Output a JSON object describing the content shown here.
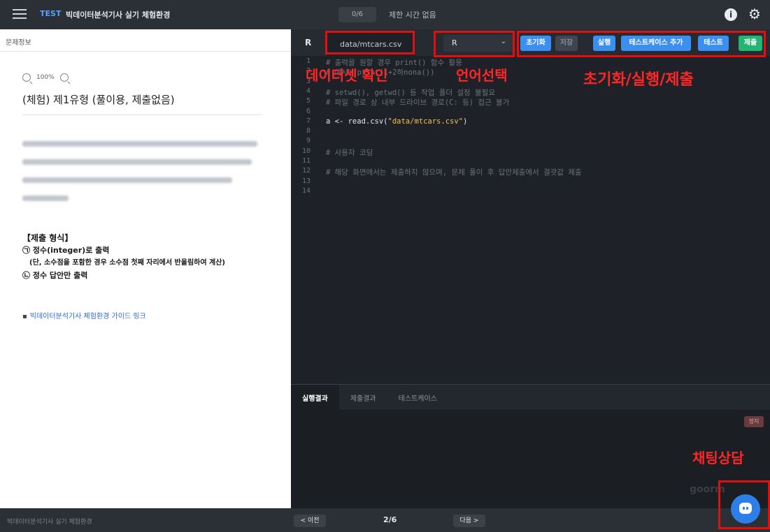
{
  "topbar": {
    "tag": "TEST",
    "title": "빅데이터분석기사 실기 체험환경",
    "progress": "0/6",
    "time_limit": "제한 시간 없음"
  },
  "left": {
    "header": "문제정보",
    "zoom": "100%",
    "question_title": "(체험) 제1유형 (풀이용, 제출없음)",
    "format_heading": "【제출 형식】",
    "format_1": "㉠ 정수(integer)로 출력",
    "format_1_note": "(단, 소수점을 포함한 경우 소수점 첫째 자리에서 반올림하여 계산)",
    "format_2": "㉡ 정수 답안만 출력",
    "guide_bullet": "▪",
    "guide_link": "빅데이터분석기사 체험환경 가이드 링크"
  },
  "editor": {
    "lang_badge": "R",
    "file_tab": "data/mtcars.csv",
    "language": "R",
    "buttons": {
      "reset": "초기화",
      "save": "저장",
      "run": "실행",
      "add_testcase": "테스트케이스 추가",
      "test": "테스트",
      "submit": "제출"
    },
    "lines": [
      {
        "n": "1",
        "parts": [
          {
            "c": "cm",
            "t": "# 출력을 원할 경우 print() 함수 활용"
          }
        ]
      },
      {
        "n": "2",
        "parts": [
          {
            "c": "cm",
            "t": "# 예시) print(1+2하nona())"
          }
        ]
      },
      {
        "n": "3",
        "parts": []
      },
      {
        "n": "4",
        "parts": [
          {
            "c": "cm",
            "t": "# setwd(), getwd() 등 작업 폴더 설정 불필요"
          }
        ]
      },
      {
        "n": "5",
        "parts": [
          {
            "c": "cm",
            "t": "# 파일 경로 상 내부 드라이브 경로(C: 등) 접근 불가"
          }
        ]
      },
      {
        "n": "6",
        "parts": []
      },
      {
        "n": "7",
        "parts": [
          {
            "c": "cd",
            "t": "a <- read.csv("
          },
          {
            "c": "str",
            "t": "\"data/mtcars.csv\""
          },
          {
            "c": "cd",
            "t": ")"
          }
        ]
      },
      {
        "n": "8",
        "parts": []
      },
      {
        "n": "9",
        "parts": []
      },
      {
        "n": "10",
        "parts": [
          {
            "c": "cm",
            "t": "# 사용자 코딩"
          }
        ]
      },
      {
        "n": "11",
        "parts": []
      },
      {
        "n": "12",
        "parts": [
          {
            "c": "cm",
            "t": "# 해당 화면에서는 제출하지 않으며, 문제 풀이 후 답안제출에서 결괏값 제출"
          }
        ]
      },
      {
        "n": "13",
        "parts": []
      },
      {
        "n": "14",
        "parts": []
      }
    ]
  },
  "annotations": {
    "dataset": "데이터셋 확인",
    "language": "언어선택",
    "actions": "초기화/실행/제출",
    "chat": "채팅상담"
  },
  "result": {
    "tabs": [
      "실행결과",
      "제출결과",
      "테스트케이스"
    ],
    "stop": "정지",
    "watermark": "goorm"
  },
  "footer": {
    "title": "빅데이터분석기사 실기 체험환경",
    "prev": "< 이전",
    "page": "2/6",
    "next": "다음 >"
  },
  "colors": {
    "accent_blue": "#3b8ff0",
    "submit_green": "#22b573",
    "annotation_red": "#ff2626"
  }
}
